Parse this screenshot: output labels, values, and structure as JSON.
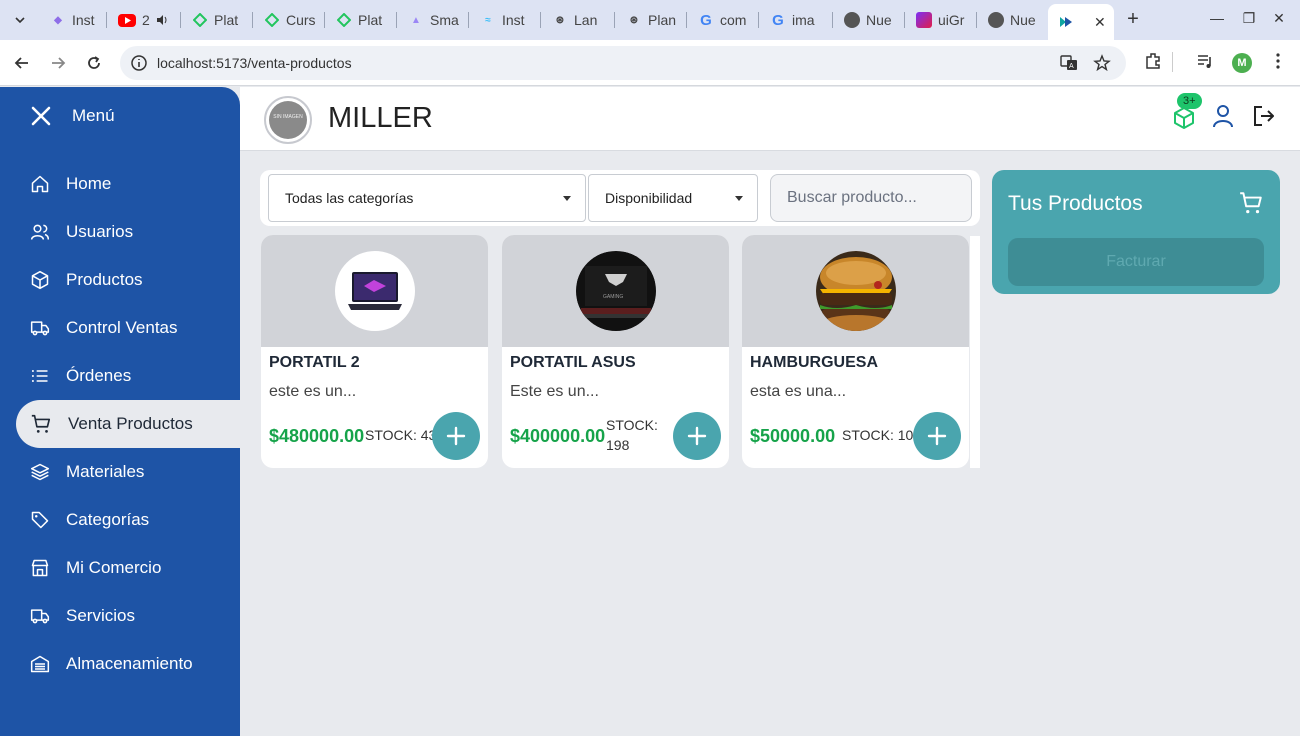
{
  "browser": {
    "tabs": [
      {
        "label": "Inst",
        "fav_color": "#8e6ee8"
      },
      {
        "label": "2",
        "fav_color": "#ff0000"
      },
      {
        "label": "Plat",
        "fav_color": "#22c55e"
      },
      {
        "label": "Curs",
        "fav_color": "#22c55e"
      },
      {
        "label": "Plat",
        "fav_color": "#22c55e"
      },
      {
        "label": "Sma",
        "fav_color": "#9b87f5"
      },
      {
        "label": "Inst",
        "fav_color": "#38bdf8"
      },
      {
        "label": "Lan",
        "fav_color": "#444444"
      },
      {
        "label": "Plan",
        "fav_color": "#444444"
      },
      {
        "label": "com",
        "fav_color": "#4285f4"
      },
      {
        "label": "ima",
        "fav_color": "#4285f4"
      },
      {
        "label": "Nue",
        "fav_color": "#555555"
      },
      {
        "label": "uiGr",
        "fav_color": "#b5179e"
      },
      {
        "label": "Nue",
        "fav_color": "#555555"
      }
    ],
    "active_tab": {
      "label": "",
      "fav_color": "#0ea5a0"
    },
    "url": "localhost:5173/venta-productos",
    "profile_initial": "M"
  },
  "sidebar": {
    "menu_label": "Menú",
    "items": [
      {
        "label": "Home",
        "icon": "home-icon"
      },
      {
        "label": "Usuarios",
        "icon": "users-icon"
      },
      {
        "label": "Productos",
        "icon": "cube-icon"
      },
      {
        "label": "Control Ventas",
        "icon": "truck-icon"
      },
      {
        "label": "Órdenes",
        "icon": "list-icon"
      },
      {
        "label": "Venta Productos",
        "icon": "cart-icon"
      },
      {
        "label": "Materiales",
        "icon": "layers-icon"
      },
      {
        "label": "Categorías",
        "icon": "tag-icon"
      },
      {
        "label": "Mi Comercio",
        "icon": "store-icon"
      },
      {
        "label": "Servicios",
        "icon": "truck-icon"
      },
      {
        "label": "Almacenamiento",
        "icon": "storage-icon"
      }
    ],
    "active_item": "Venta Productos"
  },
  "header": {
    "logo_text": "SIN IMAGEN",
    "brand": "MILLER",
    "notification_badge": "3+"
  },
  "filters": {
    "category_select": "Todas las categorías",
    "availability_select": "Disponibilidad",
    "search_placeholder": "Buscar producto..."
  },
  "products": [
    {
      "name": "PORTATIL 2",
      "description": "este es un...",
      "price": "$480000.00",
      "stock_label": "STOCK: 43",
      "image": "laptop-image"
    },
    {
      "name": "PORTATIL ASUS",
      "description": "Este es un...",
      "price": "$400000.00",
      "stock_label_line1": "STOCK:",
      "stock_label_line2": "198",
      "image": "laptop-dark-image"
    },
    {
      "name": "HAMBURGUESA",
      "description": "esta es una...",
      "price": "$50000.00",
      "stock_label": "STOCK: 10",
      "image": "burger-image"
    }
  ],
  "cart": {
    "title": "Tus Productos",
    "bill_button": "Facturar"
  },
  "colors": {
    "sidebar": "#1e54a6",
    "accent_teal": "#4aa5ae",
    "price_green": "#16a34a",
    "badge_green": "#1ec46b"
  }
}
